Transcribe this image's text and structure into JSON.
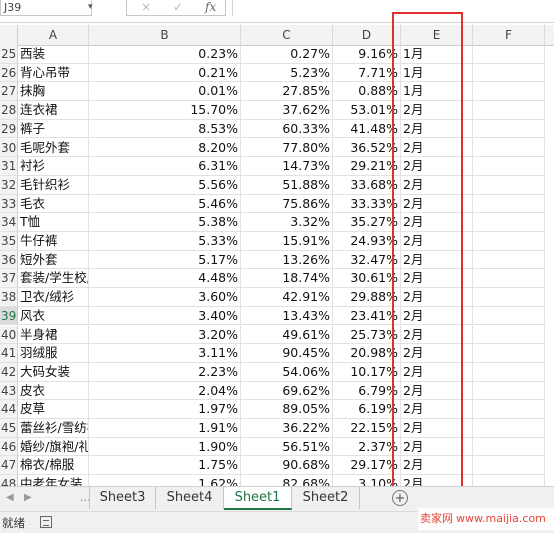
{
  "formula_bar": {
    "name_box": "J39",
    "cancel_icon": "×",
    "enter_icon": "✓",
    "fx_label": "fx",
    "formula": ""
  },
  "columns": [
    "A",
    "B",
    "C",
    "D",
    "E",
    "F"
  ],
  "rows": [
    {
      "n": "25",
      "a": "西装",
      "b": "0.23%",
      "c": "0.27%",
      "d": "9.16%",
      "e": "1月"
    },
    {
      "n": "26",
      "a": "背心吊带",
      "b": "0.21%",
      "c": "5.23%",
      "d": "7.71%",
      "e": "1月"
    },
    {
      "n": "27",
      "a": "抹胸",
      "b": "0.01%",
      "c": "27.85%",
      "d": "0.88%",
      "e": "1月"
    },
    {
      "n": "28",
      "a": "连衣裙",
      "b": "15.70%",
      "c": "37.62%",
      "d": "53.01%",
      "e": "2月"
    },
    {
      "n": "29",
      "a": "裤子",
      "b": "8.53%",
      "c": "60.33%",
      "d": "41.48%",
      "e": "2月"
    },
    {
      "n": "30",
      "a": "毛呢外套",
      "b": "8.20%",
      "c": "77.80%",
      "d": "36.52%",
      "e": "2月"
    },
    {
      "n": "31",
      "a": "衬衫",
      "b": "6.31%",
      "c": "14.73%",
      "d": "29.21%",
      "e": "2月"
    },
    {
      "n": "32",
      "a": "毛针织衫",
      "b": "5.56%",
      "c": "51.88%",
      "d": "33.68%",
      "e": "2月"
    },
    {
      "n": "33",
      "a": "毛衣",
      "b": "5.46%",
      "c": "75.86%",
      "d": "33.33%",
      "e": "2月"
    },
    {
      "n": "34",
      "a": "T恤",
      "b": "5.38%",
      "c": "3.32%",
      "d": "35.27%",
      "e": "2月"
    },
    {
      "n": "35",
      "a": "牛仔裤",
      "b": "5.33%",
      "c": "15.91%",
      "d": "24.93%",
      "e": "2月"
    },
    {
      "n": "36",
      "a": "短外套",
      "b": "5.17%",
      "c": "13.26%",
      "d": "32.47%",
      "e": "2月"
    },
    {
      "n": "37",
      "a": "套装/学生校服",
      "b": "4.48%",
      "c": "18.74%",
      "d": "30.61%",
      "e": "2月"
    },
    {
      "n": "38",
      "a": "卫衣/绒衫",
      "b": "3.60%",
      "c": "42.91%",
      "d": "29.88%",
      "e": "2月"
    },
    {
      "n": "39",
      "a": "风衣",
      "b": "3.40%",
      "c": "13.43%",
      "d": "23.41%",
      "e": "2月"
    },
    {
      "n": "40",
      "a": "半身裙",
      "b": "3.20%",
      "c": "49.61%",
      "d": "25.73%",
      "e": "2月"
    },
    {
      "n": "41",
      "a": "羽绒服",
      "b": "3.11%",
      "c": "90.45%",
      "d": "20.98%",
      "e": "2月"
    },
    {
      "n": "42",
      "a": "大码女装",
      "b": "2.23%",
      "c": "54.06%",
      "d": "10.17%",
      "e": "2月"
    },
    {
      "n": "43",
      "a": "皮衣",
      "b": "2.04%",
      "c": "69.62%",
      "d": "6.79%",
      "e": "2月"
    },
    {
      "n": "44",
      "a": "皮草",
      "b": "1.97%",
      "c": "89.05%",
      "d": "6.19%",
      "e": "2月"
    },
    {
      "n": "45",
      "a": "蕾丝衫/雪纺衫",
      "b": "1.91%",
      "c": "36.22%",
      "d": "22.15%",
      "e": "2月"
    },
    {
      "n": "46",
      "a": "婚纱/旗袍/礼服",
      "b": "1.90%",
      "c": "56.51%",
      "d": "2.37%",
      "e": "2月"
    },
    {
      "n": "47",
      "a": "棉衣/棉服",
      "b": "1.75%",
      "c": "90.68%",
      "d": "29.17%",
      "e": "2月"
    },
    {
      "n": "48",
      "a": "中老年女装",
      "b": "1.62%",
      "c": "82.68%",
      "d": "3.10%",
      "e": "2月"
    }
  ],
  "selected_row": "39",
  "sheet_tabs": [
    "Sheet3",
    "Sheet4",
    "Sheet1",
    "Sheet2"
  ],
  "active_sheet": "Sheet1",
  "tab_nav": {
    "prev": "◀",
    "next": "▶",
    "more": "..."
  },
  "add_sheet": "+",
  "status": {
    "text": "就绪"
  },
  "watermark": {
    "brand": "卖家网",
    "url": "www.maijia.com"
  },
  "colors": {
    "highlight": "#e23030",
    "accent": "#217346",
    "watermark": "#e8463b"
  }
}
